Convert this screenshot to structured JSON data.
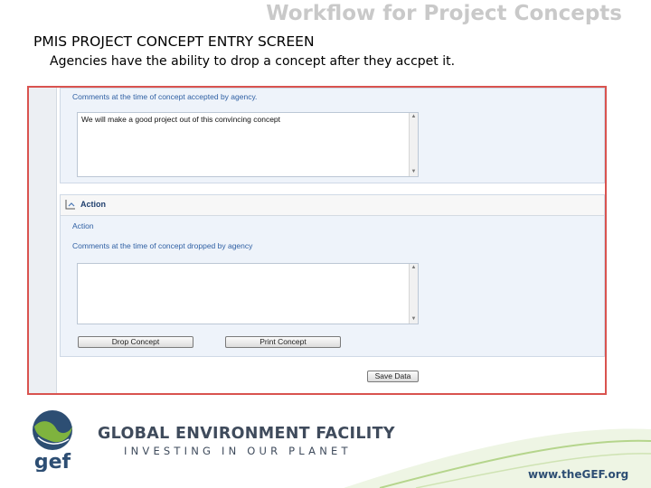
{
  "slide": {
    "title": "Workflow for Project Concepts",
    "heading": "PMIS PROJECT CONCEPT ENTRY SCREEN",
    "subtext": "Agencies have the ability to drop a concept after they accpet it."
  },
  "screenshot": {
    "accepted_label": "Comments at the time of concept accepted by agency.",
    "accepted_comment": "We will make a good project out of this convincing concept",
    "action_section_title": "Action",
    "action_label": "Action",
    "dropped_label": "Comments at the time of concept dropped by agency",
    "dropped_comment": "",
    "drop_button": "Drop Concept",
    "print_button": "Print Concept",
    "save_button": "Save Data"
  },
  "footer": {
    "logo_text": "gef",
    "org_name": "GLOBAL ENVIRONMENT FACILITY",
    "tagline": "INVESTING IN OUR PLANET",
    "website": "www.theGEF.org"
  },
  "colors": {
    "title_gray": "#c9c9c9",
    "screenshot_border": "#d9534f",
    "panel_bg": "#eef3fa",
    "label_blue": "#2e5fa3",
    "gef_green": "#7fb33e",
    "gef_navy": "#2d4e73"
  },
  "icons": {
    "collapse": "collapse-icon",
    "globe": "globe-logo",
    "scroll_up": "scroll-up-arrow-icon",
    "scroll_down": "scroll-down-arrow-icon"
  }
}
